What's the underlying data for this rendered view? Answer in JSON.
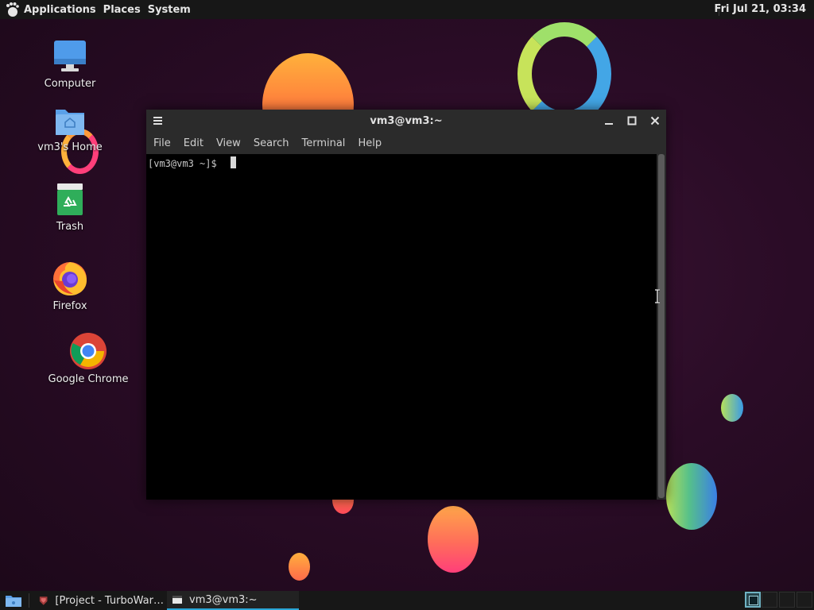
{
  "top_panel": {
    "menus": [
      "Applications",
      "Places",
      "System"
    ],
    "clock": "Fri Jul 21, 03:34"
  },
  "desktop_icons": [
    {
      "label": "Computer",
      "icon": "computer-icon"
    },
    {
      "label": "vm3's Home",
      "icon": "home-folder-icon"
    },
    {
      "label": "Trash",
      "icon": "trash-icon"
    },
    {
      "label": "Firefox",
      "icon": "firefox-icon"
    },
    {
      "label": "Google Chrome",
      "icon": "chrome-icon"
    }
  ],
  "terminal": {
    "title": "vm3@vm3:~",
    "menus": [
      "File",
      "Edit",
      "View",
      "Search",
      "Terminal",
      "Help"
    ],
    "prompt": "[vm3@vm3 ~]$ "
  },
  "taskbar": {
    "tasks": [
      {
        "label": "[Project - TurboWar…",
        "icon": "turbowarp-icon",
        "active": false
      },
      {
        "label": "vm3@vm3:~",
        "icon": "terminal-icon",
        "active": true
      }
    ],
    "workspaces": 4,
    "current_workspace": 1
  },
  "colors": {
    "panel": "#171717",
    "titlebar": "#2b2b2b",
    "accent": "#2aa6d6",
    "desktop": "#2a0c26"
  }
}
